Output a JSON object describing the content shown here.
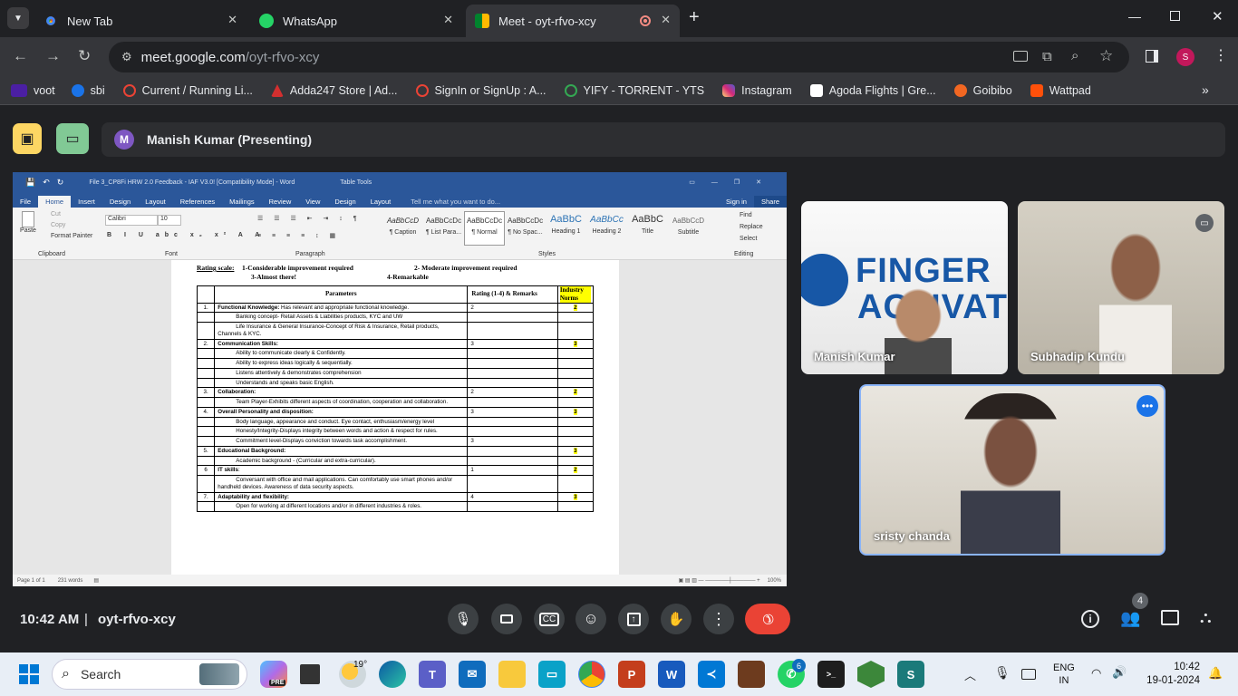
{
  "browser": {
    "tabs": [
      {
        "title": "New Tab"
      },
      {
        "title": "WhatsApp"
      },
      {
        "title": "Meet - oyt-rfvo-xcy"
      }
    ],
    "new_tab": "+",
    "url_host": "meet.google.com",
    "url_path": "/oyt-rfvo-xcy",
    "profile_initial": "S",
    "bookmarks": [
      "voot",
      "sbi",
      "Current / Running Li...",
      "Adda247 Store | Ad...",
      "SignIn or SignUp : A...",
      "YIFY - TORRENT - YTS",
      "Instagram",
      "Agoda Flights | Gre...",
      "Goibibo",
      "Wattpad"
    ]
  },
  "meet": {
    "presenter_initial": "M",
    "presenter_label": "Manish Kumar (Presenting)",
    "participants": [
      "Manish Kumar",
      "Subhadip Kundu",
      "sristy chanda"
    ],
    "tile_logo_line1": "FINGER",
    "tile_logo_line2": "ACTIVAT",
    "time": "10:42 AM",
    "divider": "|",
    "meeting_code": "oyt-rfvo-xcy",
    "people_count": "4",
    "colors": {
      "end_call": "#ea4335",
      "active_border": "#8ab4f8"
    }
  },
  "word": {
    "title": "File 3_CP8Fi HRW 2.0 Feedback - IAF V3.0! [Compatibility Mode] - Word",
    "context_tab": "Table Tools",
    "ribbon_tabs": [
      "File",
      "Home",
      "Insert",
      "Design",
      "Layout",
      "References",
      "Mailings",
      "Review",
      "View",
      "Design",
      "Layout"
    ],
    "tell_me": "Tell me what you want to do...",
    "sign_in": "Sign in",
    "share": "Share",
    "clipboard": {
      "paste": "Paste",
      "cut": "Cut",
      "copy": "Copy",
      "format_painter": "Format Painter",
      "group": "Clipboard"
    },
    "font": {
      "name": "Calibri",
      "size": "10",
      "group": "Font"
    },
    "paragraph_group": "Paragraph",
    "styles": [
      {
        "sample": "AaBbCcD",
        "name": "¶ Caption"
      },
      {
        "sample": "AaBbCcDc",
        "name": "¶ List Para..."
      },
      {
        "sample": "AaBbCcDc",
        "name": "¶ Normal"
      },
      {
        "sample": "AaBbCcDc",
        "name": "¶ No Spac..."
      },
      {
        "sample": "AaBbC",
        "name": "Heading 1"
      },
      {
        "sample": "AaBbCc",
        "name": "Heading 2"
      },
      {
        "sample": "AaBbC",
        "name": "Title"
      },
      {
        "sample": "AaBbCcD",
        "name": "Subtitle"
      }
    ],
    "styles_group": "Styles",
    "editing": {
      "find": "Find",
      "replace": "Replace",
      "select": "Select",
      "group": "Editing"
    },
    "status": {
      "page": "Page 1 of 1",
      "words": "231 words",
      "zoom": "100%"
    },
    "doc": {
      "scale_label": "Rating scale:",
      "scale_1": "1-Considerable improvement required",
      "scale_2": "2- Moderate improvement required",
      "scale_3": "3-Almost there!",
      "scale_4": "4-Remarkable",
      "col_params": "Parameters",
      "col_rating": "Rating (1-4) & Remarks",
      "col_norms": "Industry Norms",
      "rows": [
        {
          "no": "1.",
          "param_b": "Functional Knowledge:",
          "param": " Has relevant and appropriate functional knowledge.",
          "rating": "2",
          "norm": "2"
        },
        {
          "no": "",
          "param_b": "",
          "param": "Banking concept- Retail Assets & Liabilities products, KYC and UW",
          "rating": "",
          "norm": "",
          "indent": true
        },
        {
          "no": "",
          "param_b": "",
          "param": "Life Insurance & General Insurance-Concept of Risk & Insurance, Retail products, Channels & KYC.",
          "rating": "",
          "norm": "",
          "indent": true
        },
        {
          "no": "2.",
          "param_b": "Communication Skills:",
          "param": "",
          "rating": "3",
          "norm": "3"
        },
        {
          "no": "",
          "param_b": "",
          "param": "Ability to communicate clearly & Confidently.",
          "rating": "",
          "norm": "",
          "indent": true
        },
        {
          "no": "",
          "param_b": "",
          "param": "Ability to express ideas logically & sequentially.",
          "rating": "",
          "norm": "",
          "indent": true
        },
        {
          "no": "",
          "param_b": "",
          "param": "Listens attentively & demonstrates comprehension",
          "rating": "",
          "norm": "",
          "indent": true
        },
        {
          "no": "",
          "param_b": "",
          "param": "Understands and speaks basic English.",
          "rating": "",
          "norm": "",
          "indent": true
        },
        {
          "no": "3.",
          "param_b": "Collaboration:",
          "param": "",
          "rating": "2",
          "norm": "2"
        },
        {
          "no": "",
          "param_b": "",
          "param": "Team Player-Exhibits different aspects of coordination, cooperation and collaboration.",
          "rating": "",
          "norm": "",
          "indent": true
        },
        {
          "no": "4.",
          "param_b": "Overall Personality and disposition:",
          "param": "",
          "rating": "3",
          "norm": "3"
        },
        {
          "no": "",
          "param_b": "",
          "param": "Body language, appearance and conduct. Eye contact, enthusiasm/energy level",
          "rating": "",
          "norm": "",
          "indent": true
        },
        {
          "no": "",
          "param_b": "",
          "param": "Honesty/Integrity-Displays integrity between words and action & respect for rules.",
          "rating": "",
          "norm": "",
          "indent": true
        },
        {
          "no": "",
          "param_b": "",
          "param": "Commitment level-Displays conviction towards task accomplishment.",
          "rating": "3",
          "norm": "",
          "indent": true
        },
        {
          "no": "5.",
          "param_b": "Educational Background:",
          "param": "",
          "rating": "",
          "norm": "3"
        },
        {
          "no": "",
          "param_b": "",
          "param": "Academic background - (Curricular and extra-curricular).",
          "rating": "",
          "norm": "",
          "indent": true
        },
        {
          "no": "6",
          "param_b": "IT skills",
          "param": ":",
          "rating": "1",
          "norm": "2"
        },
        {
          "no": "",
          "param_b": "",
          "param": "Conversant with office and mail applications. Can comfortably use smart phones and/or handheld devices. Awareness of data security aspects.",
          "rating": "",
          "norm": "",
          "indent": true
        },
        {
          "no": "7.",
          "param_b": "Adaptability and flexibility:",
          "param": "",
          "rating": "4",
          "norm": "3"
        },
        {
          "no": "",
          "param_b": "",
          "param": "Open for working at different locations and/or in different industries & roles.",
          "rating": "",
          "norm": "",
          "indent": true
        }
      ]
    }
  },
  "taskbar": {
    "search": "Search",
    "weather": "19°",
    "lang1": "ENG",
    "lang2": "IN",
    "time": "10:42",
    "date": "19-01-2024",
    "teams_badge": "",
    "whatsapp_badge": "6",
    "pre_badge": "PRE"
  }
}
